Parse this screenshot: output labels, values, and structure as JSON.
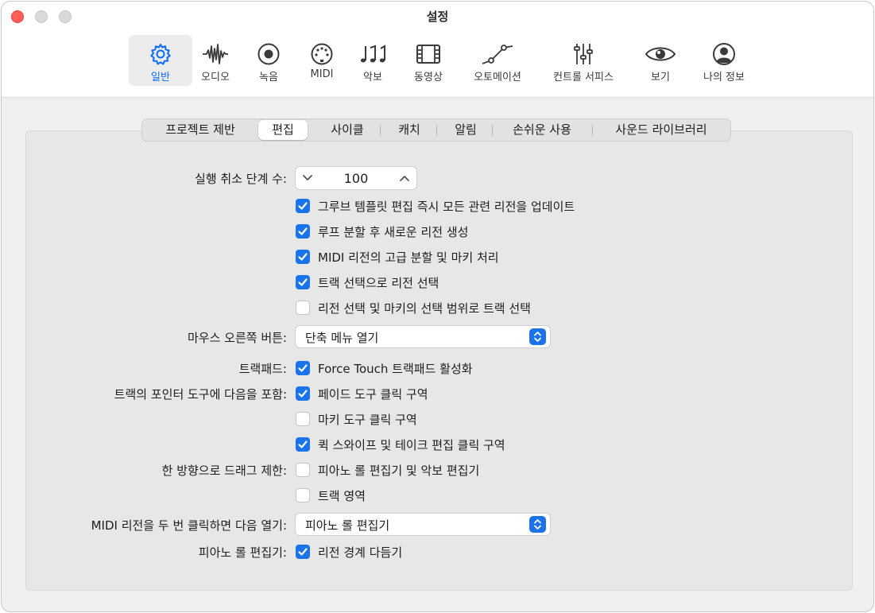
{
  "window": {
    "title": "설정"
  },
  "toolbar": {
    "items": [
      {
        "label": "일반",
        "icon": "gear-icon",
        "selected": true
      },
      {
        "label": "오디오",
        "icon": "waveform-icon"
      },
      {
        "label": "녹음",
        "icon": "record-icon"
      },
      {
        "label": "MIDI",
        "icon": "midi-connector-icon"
      },
      {
        "label": "악보",
        "icon": "music-notes-icon"
      },
      {
        "label": "동영상",
        "icon": "film-icon"
      },
      {
        "label": "오토메이션",
        "icon": "automation-curve-icon"
      },
      {
        "label": "컨트롤 서피스",
        "icon": "sliders-icon"
      },
      {
        "label": "보기",
        "icon": "eye-icon"
      },
      {
        "label": "나의 정보",
        "icon": "person-circle-icon"
      }
    ]
  },
  "tabs": [
    {
      "label": "프로젝트 제반"
    },
    {
      "label": "편집",
      "selected": true
    },
    {
      "label": "사이클"
    },
    {
      "label": "캐치"
    },
    {
      "label": "알림"
    },
    {
      "label": "손쉬운 사용"
    },
    {
      "label": "사운드 라이브러리"
    }
  ],
  "settings": {
    "undo_label": "실행 취소 단계 수:",
    "undo_value": "100",
    "checks_group1": [
      {
        "text": "그루브 템플릿 편집 즉시 모든 관련 리전을 업데이트",
        "checked": true
      },
      {
        "text": "루프 분할 후 새로운 리전 생성",
        "checked": true
      },
      {
        "text": "MIDI 리전의 고급 분할 및 마키 처리",
        "checked": true
      },
      {
        "text": "트랙 선택으로 리전 선택",
        "checked": true
      },
      {
        "text": "리전 선택 및 마키의 선택 범위로 트랙 선택",
        "checked": false
      }
    ],
    "mouse_label": "마우스 오른쪽 버튼:",
    "mouse_value": "단축 메뉴 열기",
    "trackpad_label": "트랙패드:",
    "trackpad_check": {
      "text": "Force Touch 트랙패드 활성화",
      "checked": true
    },
    "pointer_label": "트랙의 포인터 도구에 다음을 포함:",
    "pointer_checks": [
      {
        "text": "페이드 도구 클릭 구역",
        "checked": true
      },
      {
        "text": "마키 도구 클릭 구역",
        "checked": false
      },
      {
        "text": "퀵 스와이프 및 테이크 편집 클릭 구역",
        "checked": true
      }
    ],
    "drag_label": "한 방향으로 드래그 제한:",
    "drag_checks": [
      {
        "text": "피아노 롤 편집기 및 악보 편집기",
        "checked": false
      },
      {
        "text": "트랙 영역",
        "checked": false
      }
    ],
    "midi_dblclick_label": "MIDI 리전을 두 번 클릭하면 다음 열기:",
    "midi_dblclick_value": "피아노 롤 편집기",
    "pianoroll_label": "피아노 롤 편집기:",
    "pianoroll_check": {
      "text": "리전 경계 다듬기",
      "checked": true
    }
  },
  "colors": {
    "accent": "#1a73e8",
    "selected_toolbar_text": "#0a6cff"
  }
}
